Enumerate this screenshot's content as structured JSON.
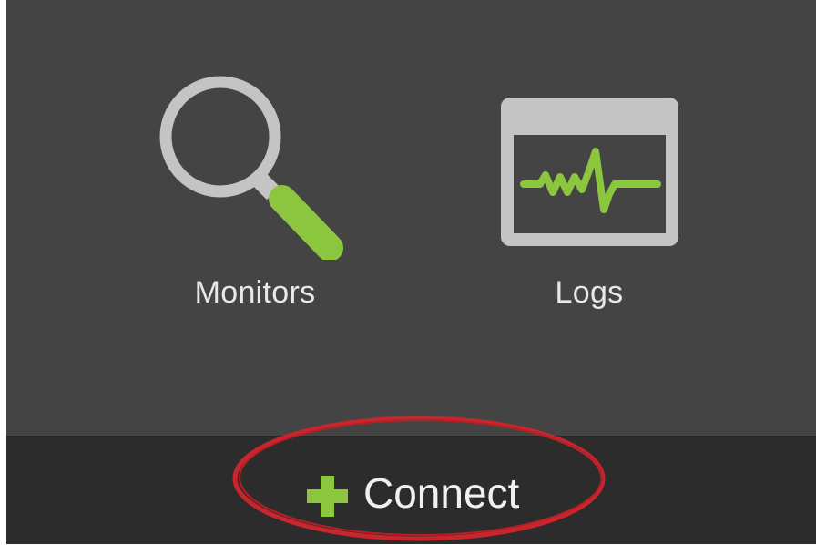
{
  "colors": {
    "background": "#444444",
    "bottom_bar": "#2c2c2c",
    "accent_green": "#8cc63f",
    "icon_gray": "#c4c4c4",
    "text": "#e8e8e8",
    "annotation_red": "#c8262c"
  },
  "tiles": [
    {
      "label": "Monitors",
      "icon": "magnifier-icon"
    },
    {
      "label": "Logs",
      "icon": "log-monitor-icon"
    }
  ],
  "bottom_bar": {
    "action_label": "Connect",
    "action_icon": "plus-icon"
  },
  "annotation": {
    "shape": "ellipse",
    "target": "connect-button",
    "color": "#c8262c"
  }
}
